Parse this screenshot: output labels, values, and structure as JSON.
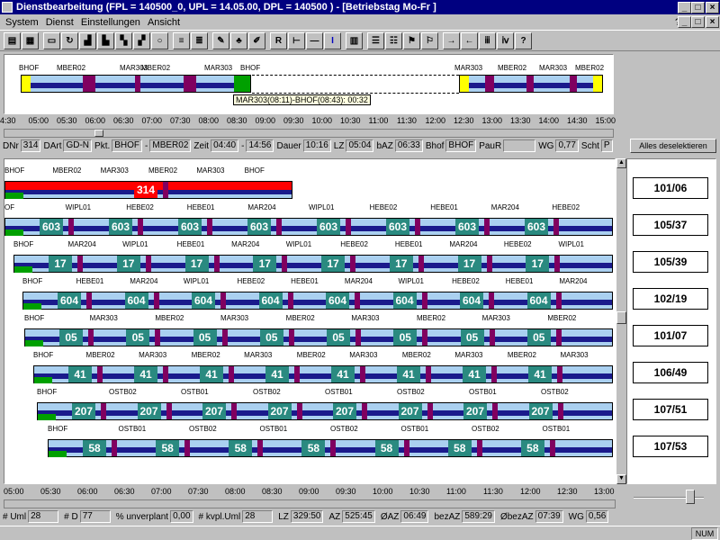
{
  "window": {
    "title": "Dienstbearbeitung (FPL = 140500_0, UPL = 14.05.00, DPL = 140500 ) - [Betriebstag Mo-Fr ]"
  },
  "menu": [
    {
      "label": "System"
    },
    {
      "label": "Dienst"
    },
    {
      "label": "Einstellungen"
    },
    {
      "label": "Ansicht"
    }
  ],
  "toolbar": {
    "r_label": "R",
    "help_label": "?"
  },
  "overview": {
    "stations_top": [
      "BHOF",
      "MBER02",
      "MAR303",
      "MBER02",
      "MAR303",
      "BHOF",
      "MAR303",
      "MBER02",
      "MAR303",
      "MBER02"
    ],
    "tooltip": "MAR303(08:11)-BHOF(08:43): 00:32"
  },
  "ruler_top": [
    "4:30",
    "05:00",
    "05:30",
    "06:00",
    "06:30",
    "07:00",
    "07:30",
    "08:00",
    "08:30",
    "09:00",
    "09:30",
    "10:00",
    "10:30",
    "11:00",
    "11:30",
    "12:00",
    "12:30",
    "13:00",
    "13:30",
    "14:00",
    "14:30",
    "15:00"
  ],
  "info": {
    "dnr_label": "DNr",
    "dnr": "314",
    "dart_label": "DArt",
    "dart": "GD-N",
    "pkt_label": "Pkt.",
    "from": "BHOF",
    "dash": "-",
    "to": "MBER02",
    "zeit_label": "Zeit",
    "start": "04:40",
    "end": "14:56",
    "dauer_label": "Dauer",
    "dauer": "10:16",
    "lz_label": "LZ",
    "lz": "05:04",
    "baz_label": "bAZ",
    "baz": "06:33",
    "bhof_label": "Bhof",
    "bhof": "BHOF",
    "paur_label": "PauR",
    "paur": "",
    "wg_label": "WG",
    "wg": "0,77",
    "scht_label": "Scht",
    "scht": "P",
    "deselect_label": "Alles deselektieren"
  },
  "rows": [
    {
      "sched": "101/06",
      "main": "314",
      "stations": [
        "BHOF",
        "MBER02",
        "MAR303",
        "MBER02",
        "MAR303",
        "BHOF"
      ]
    },
    {
      "sched": "105/37",
      "main": "603",
      "stations": [
        "OF",
        "WIPL01",
        "HEBE02",
        "HEBE01",
        "MAR204",
        "WIPL01",
        "HEBE02",
        "HEBE01",
        "MAR204",
        "HEBE02"
      ]
    },
    {
      "sched": "105/39",
      "main": "17",
      "stations": [
        "BHOF",
        "MAR204",
        "WIPL01",
        "HEBE01",
        "MAR204",
        "WIPL01",
        "HEBE02",
        "HEBE01",
        "MAR204",
        "HEBE02",
        "WIPL01"
      ]
    },
    {
      "sched": "102/19",
      "main": "604",
      "stations": [
        "BHOF",
        "HEBE01",
        "MAR204",
        "WIPL01",
        "HEBE02",
        "HEBE01",
        "MAR204",
        "WIPL01",
        "HEBE02",
        "HEBE01",
        "MAR204"
      ]
    },
    {
      "sched": "101/07",
      "main": "05",
      "stations": [
        "BHOF",
        "MAR303",
        "MBER02",
        "MAR303",
        "MBER02",
        "MAR303",
        "MBER02",
        "MAR303",
        "MBER02"
      ]
    },
    {
      "sched": "106/49",
      "main": "41",
      "stations": [
        "BHOF",
        "MBER02",
        "MAR303",
        "MBER02",
        "MAR303",
        "MBER02",
        "MAR303",
        "MBER02",
        "MAR303",
        "MBER02",
        "MAR303"
      ]
    },
    {
      "sched": "107/51",
      "main": "207",
      "stations": [
        "BHOF",
        "OSTB02",
        "OSTB01",
        "OSTB02",
        "OSTB01",
        "OSTB02",
        "OSTB01",
        "OSTB02"
      ]
    },
    {
      "sched": "107/53",
      "main": "58",
      "stations": [
        "BHOF",
        "OSTB01",
        "OSTB02",
        "OSTB01",
        "OSTB02",
        "OSTB01",
        "OSTB02",
        "OSTB01"
      ]
    }
  ],
  "ruler_bottom": [
    "05:00",
    "05:30",
    "06:00",
    "06:30",
    "07:00",
    "07:30",
    "08:00",
    "08:30",
    "09:00",
    "09:30",
    "10:00",
    "10:30",
    "11:00",
    "11:30",
    "12:00",
    "12:30",
    "13:00"
  ],
  "status": {
    "uml_label": "# Uml",
    "uml": "28",
    "d_label": "# D",
    "d": "77",
    "unv_label": "% unverplant",
    "unv": "0,00",
    "kvpl_label": "# kvpl.Uml",
    "kvpl": "28",
    "lz_label": "LZ",
    "lz": "329:50",
    "az_label": "AZ",
    "az": "525:45",
    "oaz_label": "ØAZ",
    "oaz": "06:49",
    "bezaz_label": "bezAZ",
    "bezaz": "589:29",
    "obezaz_label": "ØbezAZ",
    "obezaz": "07:39",
    "wg_label": "WG",
    "wg": "0,56",
    "num": "NUM"
  },
  "colors": {
    "dark": "#1a1a8c",
    "light": "#aad0f0",
    "teal": "#2a8a80",
    "purple": "#800060",
    "red": "#ff0000",
    "green": "#00a000",
    "yellow": "#ffff00"
  }
}
